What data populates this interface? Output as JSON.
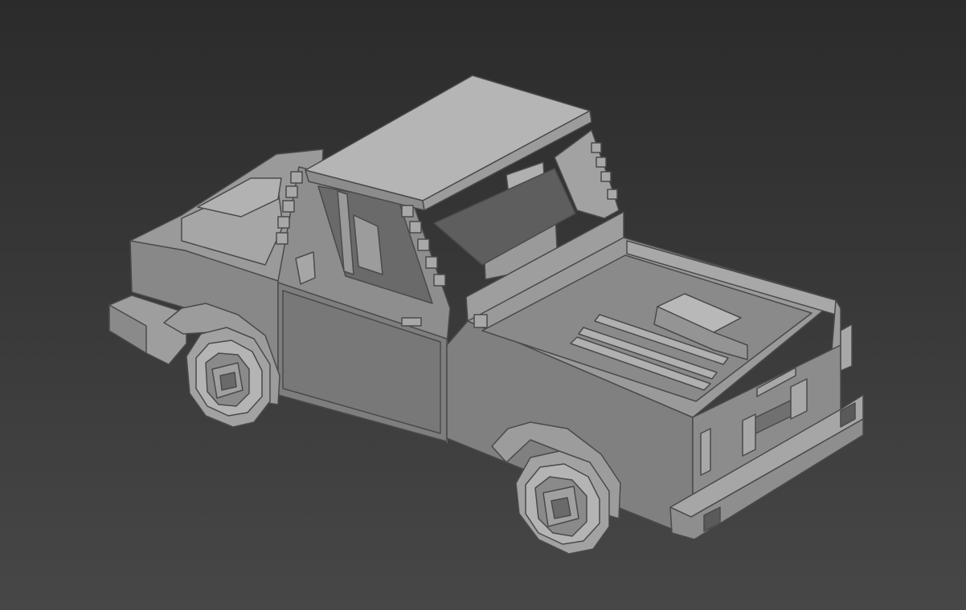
{
  "viewport": {
    "background_top": "#2b2b2b",
    "background_bottom": "#474747"
  },
  "model": {
    "kind": "voxel pickup truck",
    "shading": "flat grey",
    "colors": {
      "top": "#b8b8b8",
      "light": "#a4a4a4",
      "mid": "#8c8c8c",
      "side": "#7c7c7c",
      "dark": "#5e5e5e",
      "edge": "#4a4a4a"
    }
  }
}
